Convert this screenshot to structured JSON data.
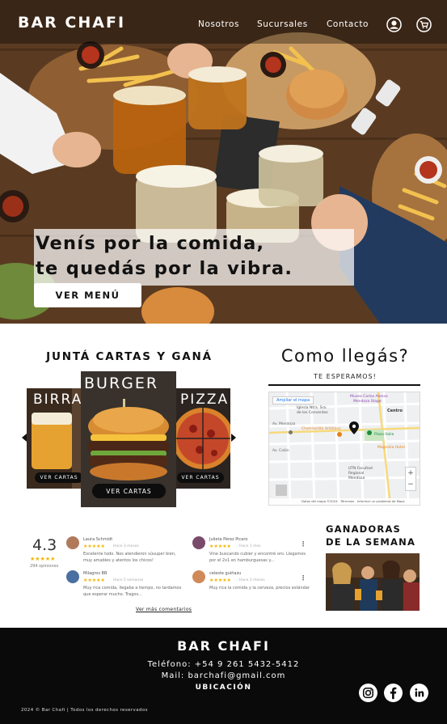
{
  "header": {
    "brand": "BAR CHAFI",
    "nav": [
      "Nosotros",
      "Sucursales",
      "Contacto"
    ],
    "icons": [
      "user-icon",
      "cart-icon"
    ]
  },
  "hero": {
    "title_line1": "Venís por la comida,",
    "title_line2": "te quedás por la vibra.",
    "cta": "VER MENÚ"
  },
  "cartas": {
    "title": "JUNTÁ CARTAS Y GANÁ",
    "cards": [
      {
        "label": "BIRRA",
        "button": "VER CARTAS"
      },
      {
        "label": "BURGER",
        "button": "VER CARTAS"
      },
      {
        "label": "PIZZA",
        "button": "VER CARTAS"
      }
    ]
  },
  "ubicacion": {
    "title": "Como llegás?",
    "subtitle": "TE ESPERAMOS!",
    "map": {
      "expand": "Ampliar el mapa",
      "place_1": "Museo Carlos Alonso",
      "place_1b": "Mendoza Stage",
      "place_2": "Iglesia Ntra. Sra.",
      "place_2b": "de los Conventos",
      "place_3": "Centro",
      "place_4": "Plaza Italia",
      "place_5": "Magnolia Hotel",
      "place_6": "Chamberlán Arístides",
      "street_1": "Av. Colón",
      "street_2": "Av. Mendoza",
      "place_7": "UTN Facultad",
      "place_7b": "Regional",
      "place_7c": "Mendoza",
      "footer_1": "Datos del mapa ©2024",
      "footer_2": "Términos",
      "footer_3": "Informar un problema de Maps"
    }
  },
  "reviews": {
    "rating": "4.3",
    "stars": "★★★★★",
    "count": "294 opiniones",
    "items": [
      {
        "name": "Laura Schmidt",
        "stars": "★★★★★",
        "time": "Hace 3 meses",
        "text": "Excelente todo. Nos atendieron súuuper bien, muy amables y atentos los chicos!",
        "color": "#b07a5a"
      },
      {
        "name": "Julieta Pérez Picaro",
        "stars": "★★★★★",
        "time": "Hace 1 mes",
        "text": "Vine buscando cubier y encontré oro. Llegamos por el 2x1 en hamburguesas y...",
        "color": "#7a4a6a"
      },
      {
        "name": "Milagros BB",
        "stars": "★★★★★",
        "time": "Hace 5 semanas",
        "text": "Muy rica comida, llegaba a tiempo, no tardamos que esperar mucho. Tragos...",
        "color": "#4a6fa0"
      },
      {
        "name": "celeste guiñazu",
        "stars": "★★★★★",
        "time": "Hace 2 meses",
        "text": "Muy rica la comida y la cerveza, precios estándar",
        "color": "#d08a5a"
      }
    ],
    "more": "Ver más comentarios"
  },
  "ganadoras": {
    "line1": "GANADORAS",
    "line2": "DE LA SEMANA"
  },
  "footer": {
    "brand": "BAR CHAFI",
    "phone": "Teléfono: +54 9 261 5432-5412",
    "mail": "Mail: barchafi@gmail.com",
    "ubicacion": "UBICACIÓN",
    "copyright": "2024 © Bar Chafi | Todos los derechos reservados",
    "social": [
      "instagram-icon",
      "facebook-icon",
      "linkedin-icon"
    ]
  },
  "colors": {
    "footer_bg": "#0a0a0a",
    "accent_pin": "#e5811b",
    "star": "#f4b400"
  }
}
